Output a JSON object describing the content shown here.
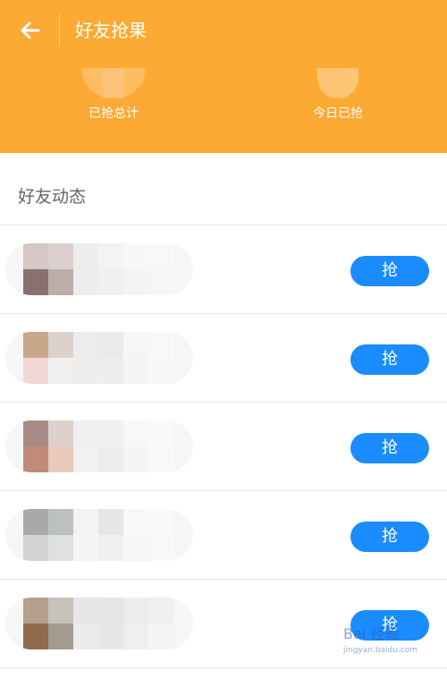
{
  "topbar": {
    "title": "好友抢果",
    "back_icon": "arrow-left-icon"
  },
  "stats": [
    {
      "label": "已抢总计",
      "blur_colors": [
        "#fdbd62",
        "#ffc47a",
        "#fcbc5f"
      ]
    },
    {
      "label": "今日已抢",
      "blur_colors": [
        "#ffc577"
      ]
    }
  ],
  "section": {
    "title": "好友动态"
  },
  "friends": [
    {
      "button": "抢",
      "blur_colors": [
        "#d6c6c6",
        "#dccfcf",
        "#ececec",
        "#f3f3f3",
        "#f7f7f7",
        "#f8f8f8",
        "#8a7070",
        "#bdaeaa",
        "#ededed",
        "#f0f0f0",
        "#f4f4f4",
        "#f6f6f6"
      ]
    },
    {
      "button": "抢",
      "blur_colors": [
        "#c7a88a",
        "#ddd2cb",
        "#ececec",
        "#eaeaea",
        "#f6f6f6",
        "#f8f8f8",
        "#f3d7d7",
        "#f2efef",
        "#ededed",
        "#eeeeee",
        "#f4f4f4",
        "#f7f7f7"
      ]
    },
    {
      "button": "抢",
      "blur_colors": [
        "#a98a84",
        "#ddd1cd",
        "#efefef",
        "#efefef",
        "#f8f8f8",
        "#fafafa",
        "#c08b78",
        "#e8c9bb",
        "#f1f1f1",
        "#ececec",
        "#f5f5f5",
        "#f8f8f8"
      ]
    },
    {
      "button": "抢",
      "blur_colors": [
        "#a9a9a9",
        "#bcc0c0",
        "#f3f3f3",
        "#e6e6e6",
        "#f8f8f8",
        "#fafafa",
        "#d4d4d4",
        "#dfe1e1",
        "#f5f5f5",
        "#efefef",
        "#f6f6f6",
        "#f8f8f8"
      ]
    },
    {
      "button": "抢",
      "blur_colors": [
        "#b59f8c",
        "#c7c1bb",
        "#e6e6e6",
        "#e5e5e5",
        "#ececec",
        "#efefef",
        "#8f6b4b",
        "#a39a92",
        "#ebebeb",
        "#e7e7e7",
        "#efefef",
        "#f4f4f4"
      ]
    }
  ],
  "watermark": {
    "text": "Bai 经验",
    "sub": "jingyan.baidu.com"
  }
}
